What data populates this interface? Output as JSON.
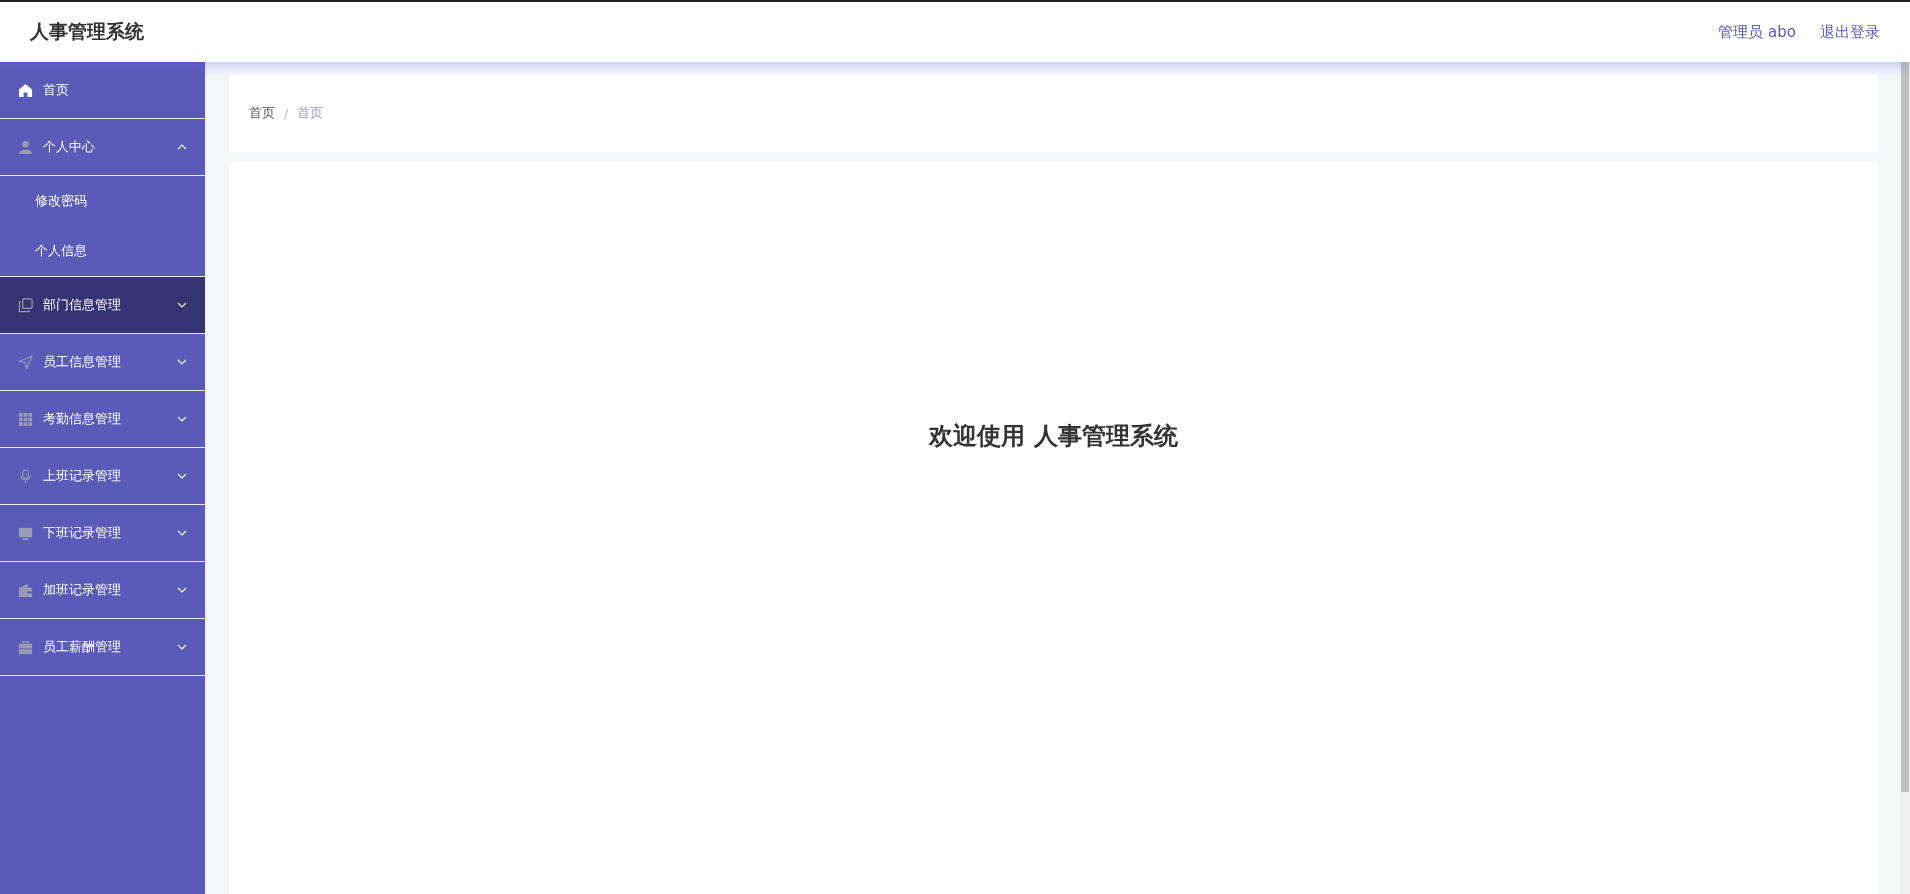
{
  "header": {
    "title": "人事管理系统",
    "user": "管理员 abo",
    "logout": "退出登录"
  },
  "sidebar": {
    "items": [
      {
        "label": "首页",
        "hovered": false
      },
      {
        "label": "个人中心",
        "hovered": false,
        "expanded": true,
        "children": [
          {
            "label": "修改密码"
          },
          {
            "label": "个人信息"
          }
        ]
      },
      {
        "label": "部门信息管理",
        "hovered": true,
        "expanded": false
      },
      {
        "label": "员工信息管理",
        "hovered": false,
        "expanded": false
      },
      {
        "label": "考勤信息管理",
        "hovered": false,
        "expanded": false
      },
      {
        "label": "上班记录管理",
        "hovered": false,
        "expanded": false
      },
      {
        "label": "下班记录管理",
        "hovered": false,
        "expanded": false
      },
      {
        "label": "加班记录管理",
        "hovered": false,
        "expanded": false
      },
      {
        "label": "员工薪酬管理",
        "hovered": false,
        "expanded": false
      }
    ]
  },
  "breadcrumb": {
    "items": [
      "首页",
      "首页"
    ],
    "separator": "/"
  },
  "welcome": "欢迎使用 人事管理系统"
}
